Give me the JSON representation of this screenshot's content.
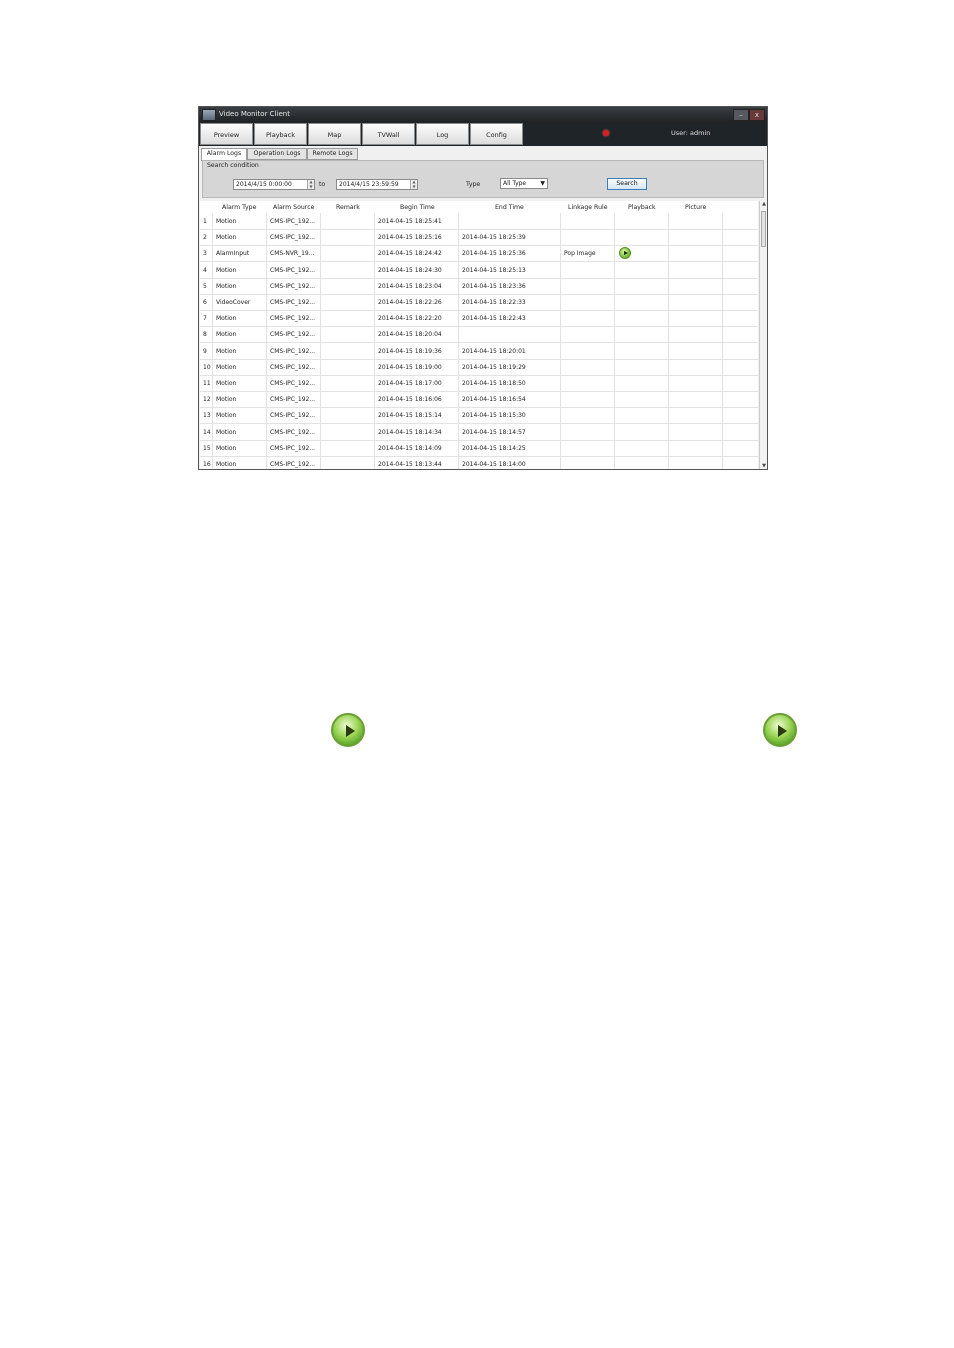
{
  "window": {
    "title": "Video Monitor Client",
    "min_label": "–",
    "close_label": "x"
  },
  "nav": {
    "buttons": [
      "Preview",
      "Playback",
      "Map",
      "TVWall",
      "Log",
      "Config"
    ],
    "user": "User: admin"
  },
  "tabs": [
    "Alarm Logs",
    "Operation Logs",
    "Remote Logs"
  ],
  "search": {
    "legend": "Search condition",
    "from": "2014/4/15 0:00:00",
    "to_label": "to",
    "to": "2014/4/15 23:59:59",
    "type_label": "Type",
    "type_value": "All Type",
    "button": "Search"
  },
  "table": {
    "columns": [
      "Alarm Type",
      "Alarm Source",
      "Remark",
      "Begin Time",
      "End Time",
      "Linkage Rule",
      "Playback",
      "Picture"
    ],
    "rows": [
      {
        "n": "1",
        "type": "Motion",
        "source": "CMS-IPC_192...",
        "begin": "2014-04-15 18:25:41",
        "end": "",
        "rule": ""
      },
      {
        "n": "2",
        "type": "Motion",
        "source": "CMS-IPC_192...",
        "begin": "2014-04-15 18:25:16",
        "end": "2014-04-15 18:25:39",
        "rule": ""
      },
      {
        "n": "3",
        "type": "AlarmInput",
        "source": "CMS-NVR_19...",
        "begin": "2014-04-15 18:24:42",
        "end": "2014-04-15 18:25:36",
        "rule": "Pop Image",
        "playback": true
      },
      {
        "n": "4",
        "type": "Motion",
        "source": "CMS-IPC_192...",
        "begin": "2014-04-15 18:24:30",
        "end": "2014-04-15 18:25:13",
        "rule": ""
      },
      {
        "n": "5",
        "type": "Motion",
        "source": "CMS-IPC_192...",
        "begin": "2014-04-15 18:23:04",
        "end": "2014-04-15 18:23:36",
        "rule": ""
      },
      {
        "n": "6",
        "type": "VideoCover",
        "source": "CMS-IPC_192...",
        "begin": "2014-04-15 18:22:26",
        "end": "2014-04-15 18:22:33",
        "rule": ""
      },
      {
        "n": "7",
        "type": "Motion",
        "source": "CMS-IPC_192...",
        "begin": "2014-04-15 18:22:20",
        "end": "2014-04-15 18:22:43",
        "rule": ""
      },
      {
        "n": "8",
        "type": "Motion",
        "source": "CMS-IPC_192...",
        "begin": "2014-04-15 18:20:04",
        "end": "",
        "rule": ""
      },
      {
        "n": "9",
        "type": "Motion",
        "source": "CMS-IPC_192...",
        "begin": "2014-04-15 18:19:36",
        "end": "2014-04-15 18:20:01",
        "rule": ""
      },
      {
        "n": "10",
        "type": "Motion",
        "source": "CMS-IPC_192...",
        "begin": "2014-04-15 18:19:00",
        "end": "2014-04-15 18:19:29",
        "rule": ""
      },
      {
        "n": "11",
        "type": "Motion",
        "source": "CMS-IPC_192...",
        "begin": "2014-04-15 18:17:00",
        "end": "2014-04-15 18:18:50",
        "rule": ""
      },
      {
        "n": "12",
        "type": "Motion",
        "source": "CMS-IPC_192...",
        "begin": "2014-04-15 18:16:06",
        "end": "2014-04-15 18:16:54",
        "rule": ""
      },
      {
        "n": "13",
        "type": "Motion",
        "source": "CMS-IPC_192...",
        "begin": "2014-04-15 18:15:14",
        "end": "2014-04-15 18:15:30",
        "rule": ""
      },
      {
        "n": "14",
        "type": "Motion",
        "source": "CMS-IPC_192...",
        "begin": "2014-04-15 18:14:34",
        "end": "2014-04-15 18:14:57",
        "rule": ""
      },
      {
        "n": "15",
        "type": "Motion",
        "source": "CMS-IPC_192...",
        "begin": "2014-04-15 18:14:09",
        "end": "2014-04-15 18:14:25",
        "rule": ""
      },
      {
        "n": "16",
        "type": "Motion",
        "source": "CMS-IPC_192...",
        "begin": "2014-04-15 18:13:44",
        "end": "2014-04-15 18:14:00",
        "rule": ""
      }
    ]
  },
  "icons": {
    "alarm": "alarm-light-icon",
    "play": "play-icon",
    "app": "monitor-icon"
  },
  "colors": {
    "titlebar": "#1f2326",
    "navbar": "#1e2427",
    "play_green": "#7cc13a",
    "alarm_red": "#d81e1e"
  }
}
